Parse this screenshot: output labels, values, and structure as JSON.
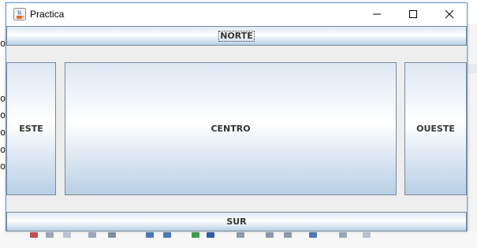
{
  "window": {
    "title": "Practica",
    "icon": "java-coffee-icon"
  },
  "controls": {
    "minimize_icon": "minimize-icon",
    "maximize_icon": "maximize-icon",
    "close_icon": "close-icon"
  },
  "buttons": {
    "norte": "NORTE",
    "este": "ESTE",
    "centro": "CENTRO",
    "oueste": "OUESTE",
    "sur": "SUR"
  },
  "background": {
    "left_glyphs": [
      "o",
      "o",
      "o",
      "o",
      "o",
      "o",
      "o"
    ]
  },
  "colors": {
    "window_border": "#6a9ad6",
    "button_gradient_top": "#dde8f3",
    "button_gradient_bottom": "#b8cfe5",
    "button_text": "#333333"
  }
}
